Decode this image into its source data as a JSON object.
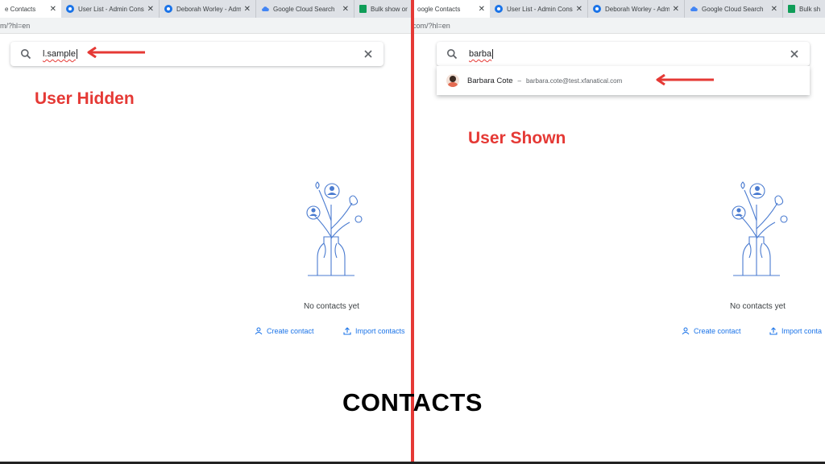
{
  "left": {
    "tabs": [
      {
        "label": "e Contacts",
        "icon": "contacts-icon",
        "active": true
      },
      {
        "label": "User List - Admin Conso",
        "icon": "admin-icon",
        "active": false
      },
      {
        "label": "Deborah Worley - Admi",
        "icon": "admin-icon",
        "active": false
      },
      {
        "label": "Google Cloud Search",
        "icon": "cloud-icon",
        "active": false
      },
      {
        "label": "Bulk show or",
        "icon": "sheets-icon",
        "active": false
      }
    ],
    "url": "m/?hl=en",
    "search_value": "l.sample",
    "annotation": "User Hidden",
    "empty_state": {
      "message": "No contacts yet",
      "create_label": "Create contact",
      "import_label": "Import contacts"
    }
  },
  "right": {
    "tabs": [
      {
        "label": "oogle Contacts",
        "icon": "contacts-icon",
        "active": true
      },
      {
        "label": "User List - Admin Conso",
        "icon": "admin-icon",
        "active": false
      },
      {
        "label": "Deborah Worley - Admi",
        "icon": "admin-icon",
        "active": false
      },
      {
        "label": "Google Cloud Search",
        "icon": "cloud-icon",
        "active": false
      },
      {
        "label": "Bulk show",
        "icon": "sheets-icon",
        "active": false
      }
    ],
    "url": "com/?hl=en",
    "search_value": "barba",
    "suggestion": {
      "name": "Barbara Cote",
      "separator": "–",
      "email": "barbara.cote@test.xfanatical.com"
    },
    "annotation": "User Shown",
    "empty_state": {
      "message": "No contacts yet",
      "create_label": "Create contact",
      "import_label": "Import conta"
    }
  },
  "caption": "CONTACTS",
  "colors": {
    "annotation_red": "#e53935",
    "link_blue": "#1a73e8",
    "illustration_blue": "#4a7bd0"
  }
}
